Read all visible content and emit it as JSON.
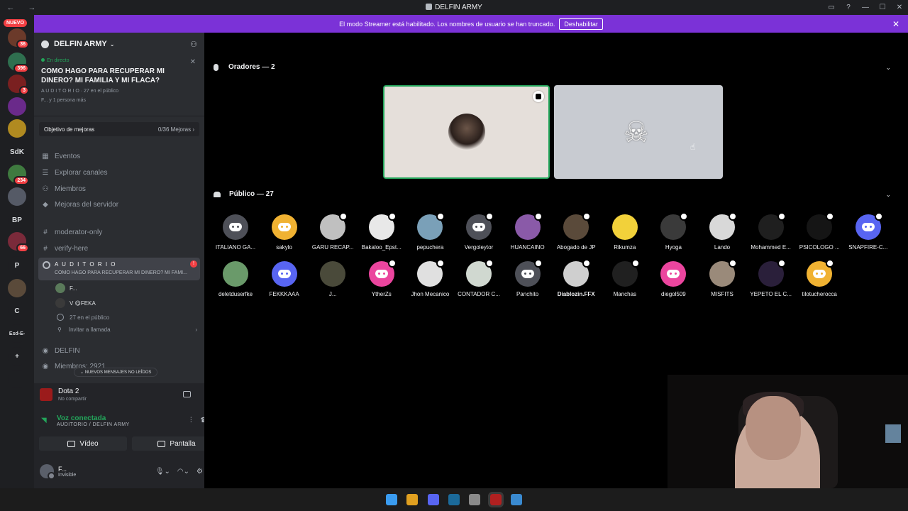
{
  "window": {
    "title": "DELFIN ARMY"
  },
  "banner": {
    "text": "El modo Streamer está habilitado. Los nombres de usuario se han truncado.",
    "button": "Deshabilitar"
  },
  "rail": {
    "nuevo": "NUEVO",
    "servers": [
      {
        "label": "",
        "badge": "36",
        "color": "#6b3a2a"
      },
      {
        "label": "",
        "badge": "396",
        "color": "#2f6f4f"
      },
      {
        "label": "",
        "badge": "3",
        "color": "#7a2020"
      },
      {
        "label": "",
        "badge": "",
        "color": "#6a2a8a"
      },
      {
        "label": "",
        "badge": "",
        "color": "#b08a20"
      },
      {
        "label": "SdK",
        "badge": "",
        "color": "#1e1f22"
      },
      {
        "label": "",
        "badge": "234",
        "color": "#3f7a3f"
      },
      {
        "label": "",
        "badge": "",
        "color": "#555a66"
      },
      {
        "label": "BP",
        "badge": "",
        "color": "#1e1f22"
      },
      {
        "label": "",
        "badge": "66",
        "color": "#7a2a3a"
      },
      {
        "label": "P",
        "badge": "",
        "color": "#1e1f22"
      },
      {
        "label": "",
        "badge": "",
        "color": "#5a4a3a"
      },
      {
        "label": "C",
        "badge": "",
        "color": "#1e1f22"
      },
      {
        "label": "Esd-E-",
        "badge": "",
        "color": "#1e1f22"
      },
      {
        "label": "+",
        "badge": "",
        "color": "#1e1f22"
      },
      {
        "label": "",
        "badge": "",
        "color": "#1e1f22"
      }
    ]
  },
  "server": {
    "name": "DELFIN ARMY",
    "live_tag": "En directo",
    "stage_topic": "COMO HAGO PARA RECUPERAR MI DINERO? MI FAMILIA Y MI FLACA?",
    "stage_meta": "A U D I T O R I O  ·  27 en el público",
    "stage_meta2": "F... y 1 persona más",
    "boost_label": "Objetivo de mejoras",
    "boost_value": "0/36 Mejoras ›",
    "nav": [
      "Eventos",
      "Explorar canales",
      "Miembros",
      "Mejoras del servidor"
    ],
    "channels": [
      "moderator-only",
      "verify-here"
    ],
    "voice_channel": {
      "name": "A U D I T O R I O",
      "sub": "COMO HAGO PARA RECUPERAR MI DINERO? MI FAMI...",
      "alert": "!",
      "users": [
        "F...",
        "V  😋FEKA"
      ],
      "audience": "27 en el público",
      "invite": "Invitar a llamada"
    },
    "channels_after": [
      "DELFIN",
      "Miembros: 2921"
    ],
    "new_messages": "NUEVOS MENSAJES NO LEÍDOS"
  },
  "panel": {
    "activity_title": "Dota 2",
    "activity_sub": "No compartir",
    "voice_status": "Voz conectada",
    "voice_location": "AUDITORIO / DELFIN ARMY",
    "video_btn": "Vídeo",
    "screen_btn": "Pantalla",
    "user_name": "F...",
    "user_status": "Invisible"
  },
  "stage": {
    "speakers_header": "Oradores — 2",
    "audience_header": "Público — 27",
    "audience_row1": [
      {
        "name": "ITALIANO GA...",
        "color": "#4e5058",
        "kind": "discord",
        "mute": false
      },
      {
        "name": "sakylo",
        "color": "#f0b232",
        "kind": "discord",
        "mute": false
      },
      {
        "name": "GARU RECAP...",
        "color": "#c0c0c0",
        "kind": "photo",
        "mute": true
      },
      {
        "name": "Bakaloo_Epst...",
        "color": "#e8e8e8",
        "kind": "photo",
        "mute": true
      },
      {
        "name": "pepuchera",
        "color": "#7aa0b8",
        "kind": "photo",
        "mute": true
      },
      {
        "name": "Vergoleytor",
        "color": "#4e5058",
        "kind": "discord",
        "mute": true
      },
      {
        "name": "HUANCAINO",
        "color": "#8a5aa8",
        "kind": "photo",
        "mute": true
      },
      {
        "name": "Abogado de JP",
        "color": "#5a4a3a",
        "kind": "photo",
        "mute": true
      },
      {
        "name": "Rikumza",
        "color": "#f2d13a",
        "kind": "photo",
        "mute": false
      },
      {
        "name": "Hyoga",
        "color": "#3a3a3a",
        "kind": "photo",
        "mute": true
      },
      {
        "name": "Lando",
        "color": "#d8d8d8",
        "kind": "photo",
        "mute": true
      },
      {
        "name": "Mohammed E...",
        "color": "#1f1f1f",
        "kind": "photo",
        "mute": true
      },
      {
        "name": "PSICOLOGO ...",
        "color": "#151515",
        "kind": "photo",
        "mute": true
      },
      {
        "name": "SNAPFIRE-C...",
        "color": "#5865f2",
        "kind": "discord",
        "mute": true
      }
    ],
    "audience_row2": [
      {
        "name": "deletduserfke",
        "color": "#6a9a6a",
        "kind": "photo",
        "mute": false
      },
      {
        "name": "FEKKKAAA",
        "color": "#5865f2",
        "kind": "discord",
        "mute": false
      },
      {
        "name": "J...",
        "color": "#4a4a3a",
        "kind": "photo",
        "mute": false
      },
      {
        "name": "YtherZs",
        "color": "#eb459e",
        "kind": "discord",
        "mute": true
      },
      {
        "name": "Jhon Mecanico",
        "color": "#e0e0e0",
        "kind": "photo",
        "mute": true
      },
      {
        "name": "CONTADOR C...",
        "color": "#d0d8d0",
        "kind": "photo",
        "mute": true
      },
      {
        "name": "Panchito",
        "color": "#4e5058",
        "kind": "discord",
        "mute": true
      },
      {
        "name": "Diablozin.FFX",
        "color": "#cfcfcf",
        "kind": "photo",
        "mute": true,
        "bold": true
      },
      {
        "name": "Manchas",
        "color": "#202020",
        "kind": "photo",
        "mute": true
      },
      {
        "name": "diegol509",
        "color": "#eb459e",
        "kind": "discord",
        "mute": false
      },
      {
        "name": "MISFITS",
        "color": "#9a8a7a",
        "kind": "photo",
        "mute": true
      },
      {
        "name": "YEPETO EL C...",
        "color": "#2a1f3a",
        "kind": "photo",
        "mute": true
      },
      {
        "name": "tilotucherocca",
        "color": "#f0b232",
        "kind": "discord",
        "mute": true
      }
    ]
  },
  "taskbar": {
    "apps": [
      {
        "name": "windows-start-icon",
        "color": "#3a9cf0"
      },
      {
        "name": "chrome-icon",
        "color": "#e0a020"
      },
      {
        "name": "discord-taskbar-icon",
        "color": "#5865f2"
      },
      {
        "name": "steam-icon",
        "color": "#1b6a9a"
      },
      {
        "name": "settings-icon",
        "color": "#8a8a8a"
      },
      {
        "name": "dota-icon",
        "color": "#b02020"
      },
      {
        "name": "notepad-icon",
        "color": "#3a8ad0"
      }
    ]
  }
}
